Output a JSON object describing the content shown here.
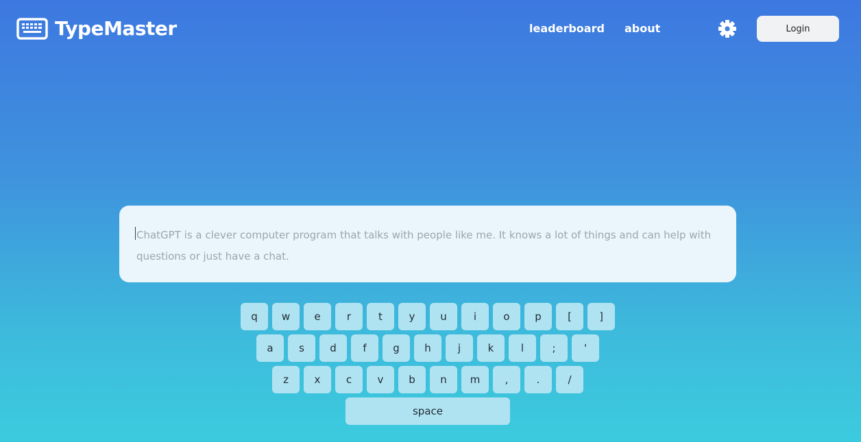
{
  "header": {
    "brand": "TypeMaster",
    "nav": [
      {
        "label": "leaderboard"
      },
      {
        "label": "about"
      }
    ],
    "login_label": "Login",
    "icons": {
      "logo": "keyboard-icon",
      "settings": "gear-icon"
    }
  },
  "typing": {
    "text": "ChatGPT is a clever computer program that talks with people like me. It knows a lot of things and can help with questions or just have a chat."
  },
  "keyboard": {
    "row1": [
      "q",
      "w",
      "e",
      "r",
      "t",
      "y",
      "u",
      "i",
      "o",
      "p",
      "[",
      "]"
    ],
    "row2": [
      "a",
      "s",
      "d",
      "f",
      "g",
      "h",
      "j",
      "k",
      "l",
      ";",
      "'"
    ],
    "row3": [
      "z",
      "x",
      "c",
      "v",
      "b",
      "n",
      "m",
      ",",
      ".",
      "/"
    ],
    "space": "space"
  },
  "colors": {
    "bg_top": "#3d78e0",
    "bg_bottom": "#3ccbde",
    "key_bg": "#b0e3f1",
    "text_box_bg": "#ebf5fc"
  }
}
